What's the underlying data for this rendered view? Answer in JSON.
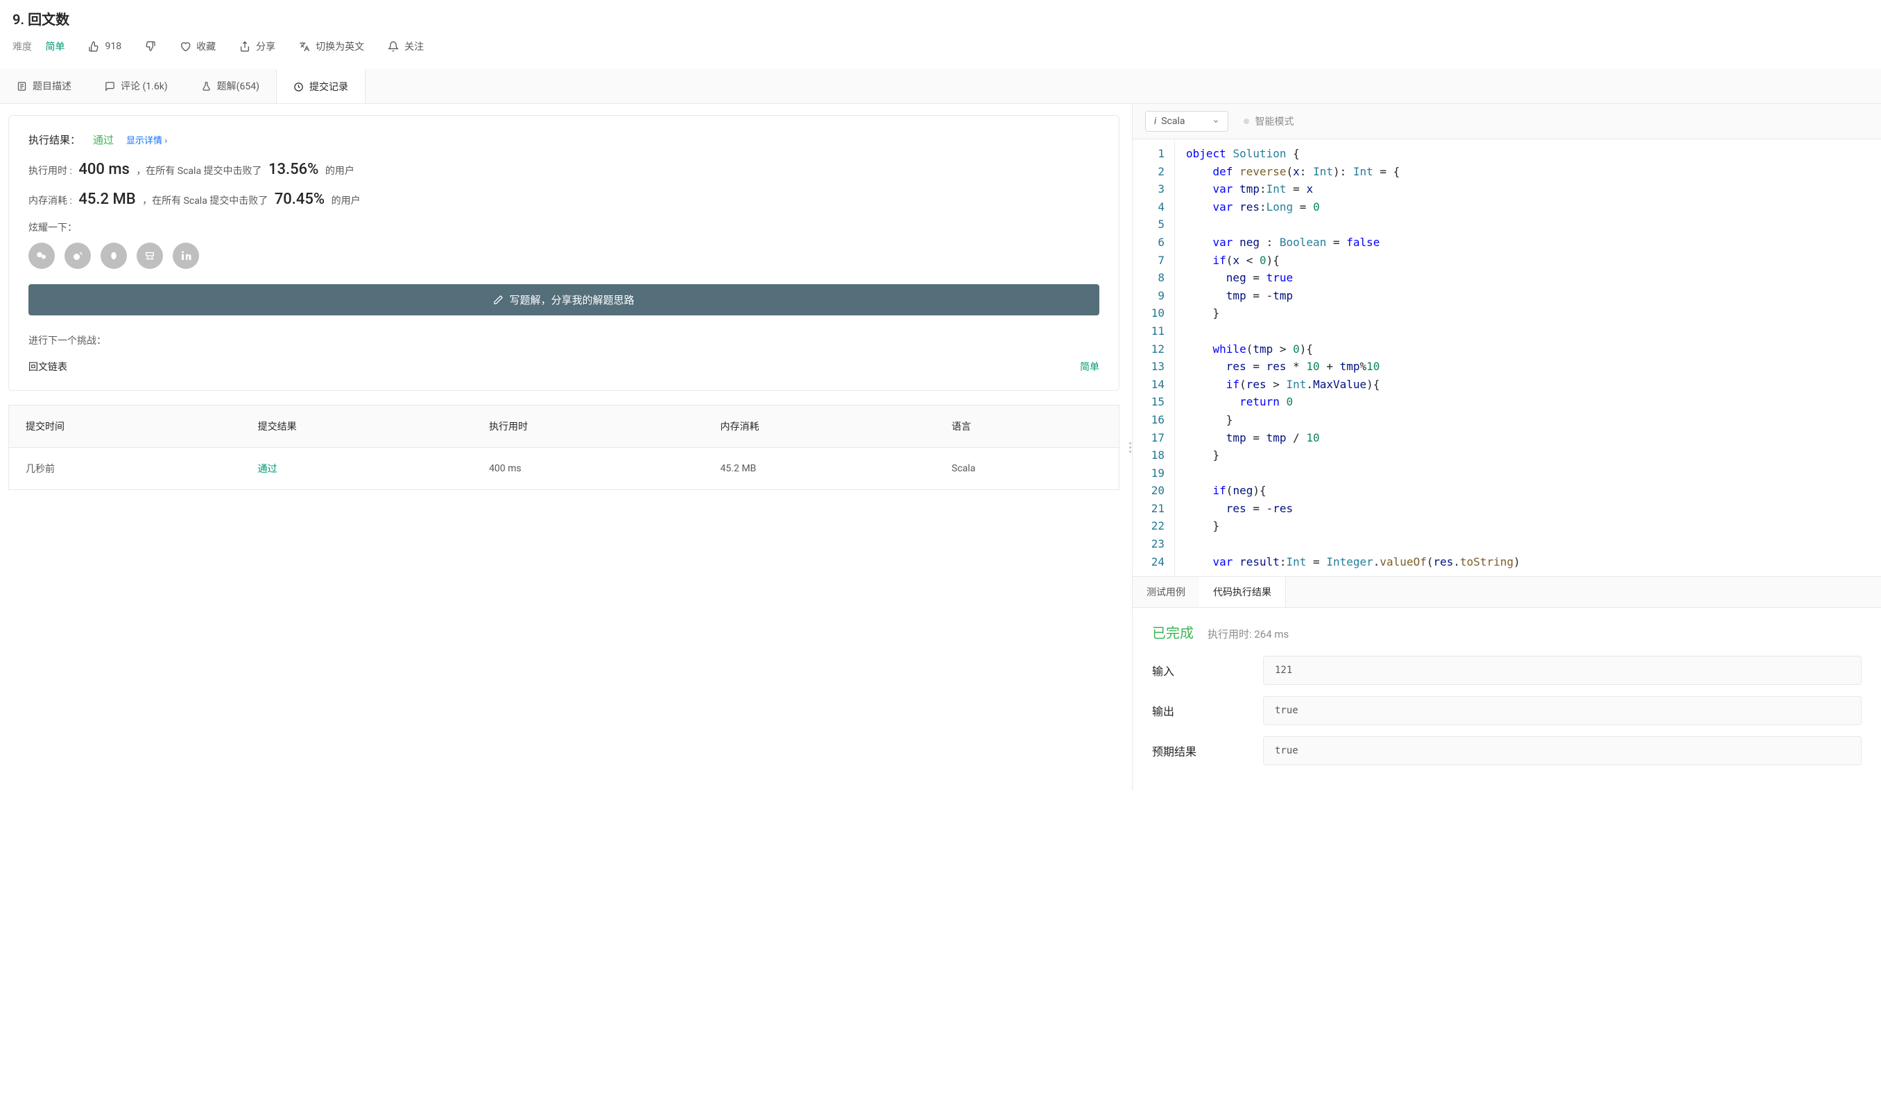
{
  "header": {
    "title": "9. 回文数",
    "difficulty_label": "难度",
    "difficulty_value": "简单",
    "likes": "918",
    "actions": {
      "favorite": "收藏",
      "share": "分享",
      "switch_lang": "切换为英文",
      "follow": "关注"
    }
  },
  "tabs": {
    "description": "题目描述",
    "comments": "评论 (1.6k)",
    "solutions": "题解(654)",
    "submissions": "提交记录"
  },
  "result": {
    "label": "执行结果：",
    "status": "通过",
    "show_detail": "显示详情 ›",
    "runtime_label_pre": "执行用时 :",
    "runtime_value": "400 ms",
    "runtime_label_mid": "，在所有 Scala 提交中击败了",
    "runtime_percent": "13.56%",
    "runtime_label_post": " 的用户",
    "memory_label_pre": "内存消耗 :",
    "memory_value": "45.2 MB",
    "memory_label_mid": "，在所有 Scala 提交中击败了",
    "memory_percent": "70.45%",
    "memory_label_post": " 的用户",
    "share_label": "炫耀一下：",
    "write_solution": "写题解，分享我的解题思路",
    "next_label": "进行下一个挑战：",
    "next_problem": "回文链表",
    "next_difficulty": "简单"
  },
  "subs_table": {
    "headers": {
      "time": "提交时间",
      "result": "提交结果",
      "runtime": "执行用时",
      "memory": "内存消耗",
      "lang": "语言"
    },
    "rows": [
      {
        "time": "几秒前",
        "result": "通过",
        "runtime": "400 ms",
        "memory": "45.2 MB",
        "lang": "Scala"
      }
    ]
  },
  "editor": {
    "language": "Scala",
    "smart_mode": "智能模式",
    "line_count": 24
  },
  "result_tabs": {
    "test": "测试用例",
    "output": "代码执行结果"
  },
  "run": {
    "status": "已完成",
    "time": "执行用时: 264 ms",
    "input_label": "输入",
    "input_value": "121",
    "output_label": "输出",
    "output_value": "true",
    "expected_label": "预期结果",
    "expected_value": "true"
  }
}
